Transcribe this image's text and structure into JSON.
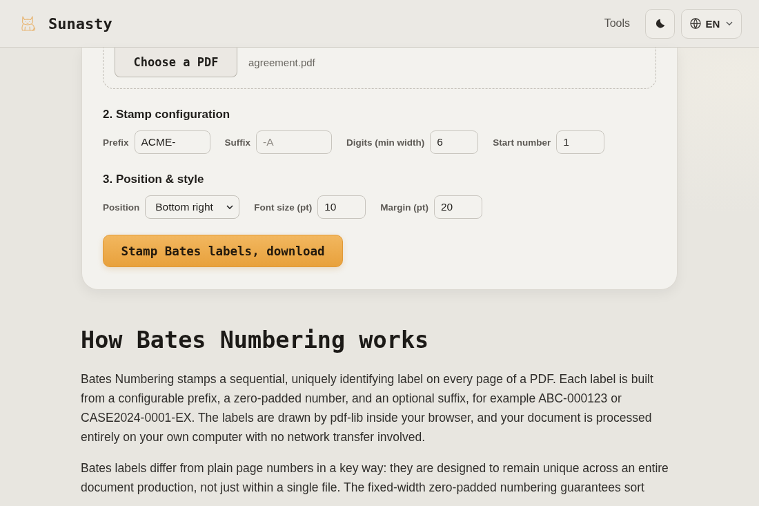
{
  "header": {
    "logo_text": "Sunasty",
    "nav": [
      {
        "label": "Tools"
      }
    ],
    "language": "EN"
  },
  "upload": {
    "button": "Choose a PDF",
    "file_name": "agreement.pdf"
  },
  "sections": [
    {
      "title": "2. Stamp configuration",
      "fields": [
        {
          "kind": "text",
          "label": "Prefix",
          "value": "ACME-"
        },
        {
          "kind": "text",
          "label": "Suffix",
          "placeholder": "-A"
        },
        {
          "kind": "number",
          "label": "Digits (min width)",
          "value": "6"
        },
        {
          "kind": "number",
          "label": "Start number",
          "value": "1"
        }
      ]
    },
    {
      "title": "3. Position & style",
      "fields": [
        {
          "kind": "select",
          "label": "Position",
          "value": "Bottom right"
        },
        {
          "kind": "number",
          "label": "Font size (pt)",
          "value": "10"
        },
        {
          "kind": "number",
          "label": "Margin (pt)",
          "value": "20"
        }
      ]
    }
  ],
  "submit_button": "Stamp Bates labels, download",
  "article": {
    "heading": "How Bates Numbering works",
    "paragraphs": [
      "Bates Numbering stamps a sequential, uniquely identifying label on every page of a PDF. Each label is built from a configurable prefix, a zero-padded number, and an optional suffix, for example ABC-000123 or CASE2024-0001-EX. The labels are drawn by pdf-lib inside your browser, and your document is processed entirely on your own computer with no network transfer involved.",
      "Bates labels differ from plain page numbers in a key way: they are designed to remain unique across an entire document production, not just within a single file. The fixed-width zero-padded numbering guarantees sort"
    ]
  }
}
